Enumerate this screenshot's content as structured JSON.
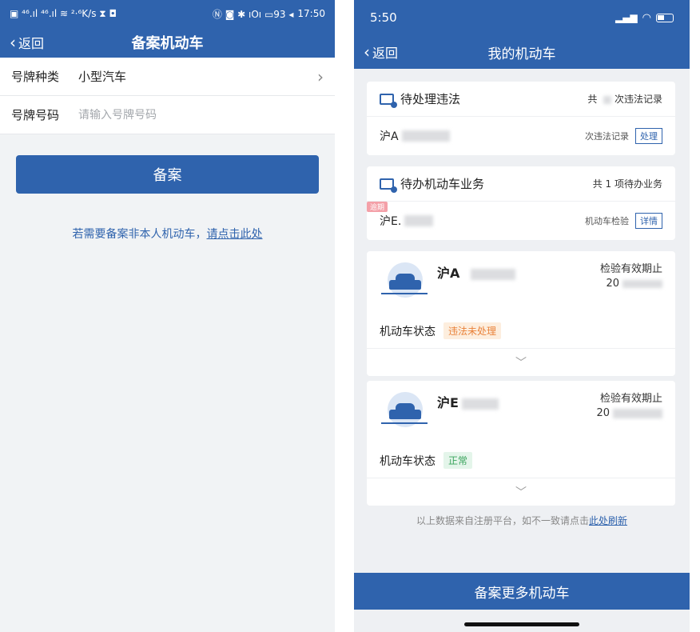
{
  "left": {
    "status": {
      "left_icons": "▣ ⁴⁶.ıl ⁴⁶.ıl ≋ ²·⁶K/s ⧗ ◘",
      "right_icons": "Ⓝ ◙ ✱ ıOı ▭93 ◂",
      "time": "17:50"
    },
    "nav": {
      "back": "返回",
      "title": "备案机动车"
    },
    "form": {
      "plate_type_label": "号牌种类",
      "plate_type_value": "小型汽车",
      "plate_no_label": "号牌号码",
      "plate_no_placeholder": "请输入号牌号码"
    },
    "submit": "备案",
    "hint_text": "若需要备案非本人机动车，",
    "hint_link": "请点击此处"
  },
  "right": {
    "status": {
      "time": "5:50"
    },
    "nav": {
      "back": "返回",
      "title": "我的机动车"
    },
    "violation_card": {
      "title": "待处理违法",
      "summary_prefix": "共",
      "summary_suffix": "次违法记录",
      "row_plate": "沪A",
      "row_note": "次违法记录",
      "row_action": "处理"
    },
    "business_card": {
      "title": "待办机动车业务",
      "summary": "共 1 项待办业务",
      "overdue_tag": "逾期",
      "row_plate": "沪E.",
      "row_note": "机动车检验",
      "row_action": "详情"
    },
    "vehicles": [
      {
        "plate": "沪A",
        "valid_label": "检验有效期止",
        "valid_value": "20",
        "state_label": "机动车状态",
        "state": "违法未处理",
        "state_color": "#e9823a",
        "state_bg": "#fdeede"
      },
      {
        "plate": "沪E",
        "valid_label": "检验有效期止",
        "valid_value": "20",
        "state_label": "机动车状态",
        "state": "正常",
        "state_color": "#3aa45c",
        "state_bg": "#e4f5ea"
      }
    ],
    "footer_text": "以上数据来自注册平台，如不一致请点击",
    "footer_link": "此处刷新",
    "bottom_button": "备案更多机动车"
  }
}
